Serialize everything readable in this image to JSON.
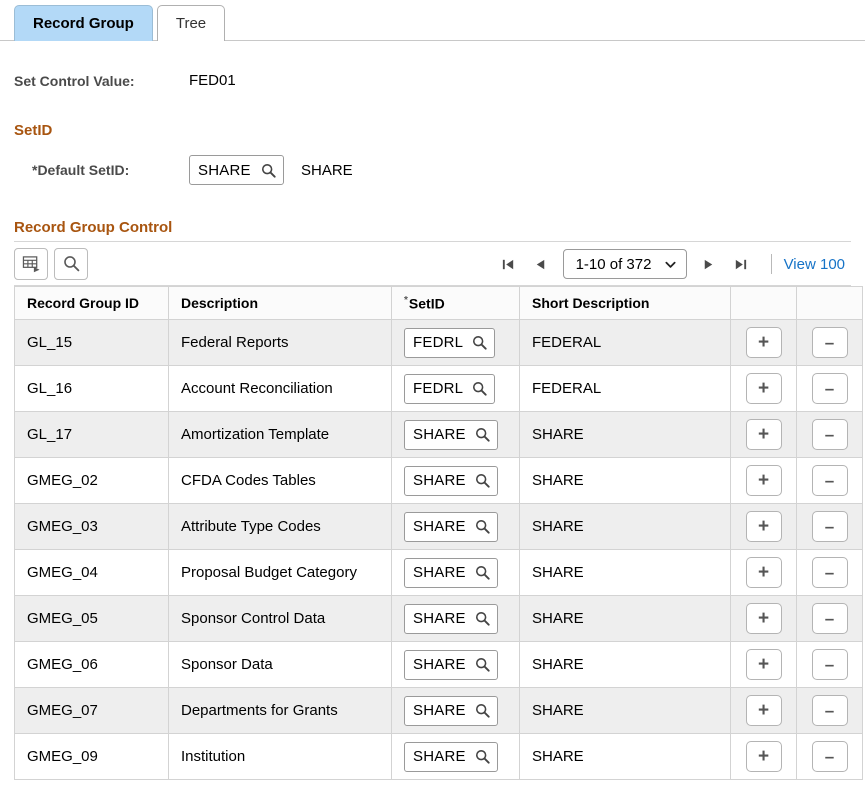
{
  "tabs": [
    {
      "label": "Record Group",
      "active": true
    },
    {
      "label": "Tree",
      "active": false
    }
  ],
  "header": {
    "set_control_label": "Set Control Value:",
    "set_control_value": "FED01"
  },
  "setid_section": {
    "title": "SetID",
    "default_setid_label": "*Default SetID:",
    "default_setid_value": "SHARE",
    "default_setid_description": "SHARE",
    "lookup_icon": "magnifier-icon"
  },
  "record_group_control": {
    "title": "Record Group Control",
    "toolbar": {
      "personalize_icon": "grid-personalize-icon",
      "find_icon": "search-icon"
    },
    "pager": {
      "first_icon": "first-page-icon",
      "prev_icon": "previous-page-icon",
      "range_label": "1-10 of 372",
      "dropdown_icon": "chevron-down-icon",
      "next_icon": "next-page-icon",
      "last_icon": "last-page-icon",
      "view_all_label": "View 100"
    },
    "columns": [
      "Record Group ID",
      "Description",
      "SetID",
      "Short Description",
      "",
      ""
    ],
    "setid_required": true,
    "row_add_label": "+",
    "row_delete_label": "–",
    "rows": [
      {
        "record_group_id": "GL_15",
        "description": "Federal Reports",
        "setid": "FEDRL",
        "short_description": "FEDERAL"
      },
      {
        "record_group_id": "GL_16",
        "description": "Account Reconciliation",
        "setid": "FEDRL",
        "short_description": "FEDERAL"
      },
      {
        "record_group_id": "GL_17",
        "description": "Amortization Template",
        "setid": "SHARE",
        "short_description": "SHARE"
      },
      {
        "record_group_id": "GMEG_02",
        "description": "CFDA Codes Tables",
        "setid": "SHARE",
        "short_description": "SHARE"
      },
      {
        "record_group_id": "GMEG_03",
        "description": "Attribute Type Codes",
        "setid": "SHARE",
        "short_description": "SHARE"
      },
      {
        "record_group_id": "GMEG_04",
        "description": "Proposal Budget Category",
        "setid": "SHARE",
        "short_description": "SHARE"
      },
      {
        "record_group_id": "GMEG_05",
        "description": "Sponsor Control Data",
        "setid": "SHARE",
        "short_description": "SHARE"
      },
      {
        "record_group_id": "GMEG_06",
        "description": "Sponsor Data",
        "setid": "SHARE",
        "short_description": "SHARE"
      },
      {
        "record_group_id": "GMEG_07",
        "description": "Departments for Grants",
        "setid": "SHARE",
        "short_description": "SHARE"
      },
      {
        "record_group_id": "GMEG_09",
        "description": "Institution",
        "setid": "SHARE",
        "short_description": "SHARE"
      }
    ]
  },
  "colors": {
    "active_tab": "#b3d9f7",
    "section_heading": "#a85510",
    "link": "#1673c7",
    "alt_row": "#eeeeee"
  }
}
